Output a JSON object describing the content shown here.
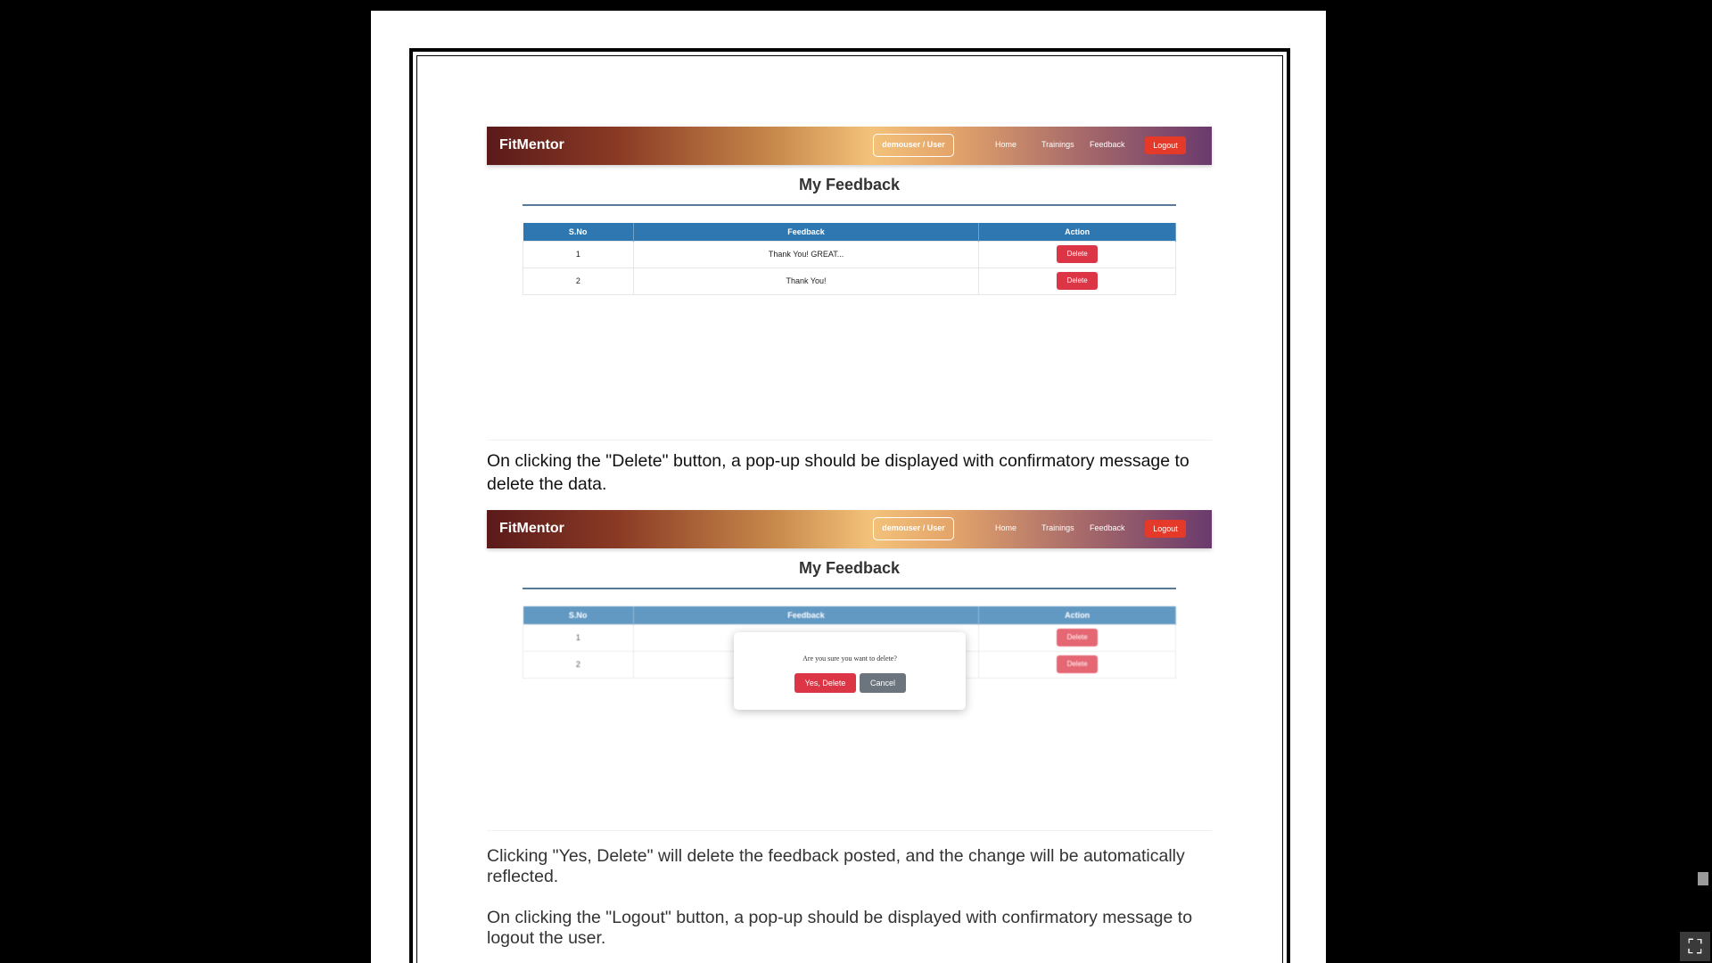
{
  "shot1": {
    "brand": "FitMentor",
    "user_badge": "demouser / User",
    "nav": {
      "home": "Home",
      "trainings": "Trainings",
      "feedback": "Feedback",
      "logout": "Logout"
    },
    "title": "My Feedback",
    "table": {
      "headers": [
        "S.No",
        "Feedback",
        "Action"
      ],
      "rows": [
        {
          "sno": "1",
          "feedback": "Thank You! GREAT...",
          "action": "Delete"
        },
        {
          "sno": "2",
          "feedback": "Thank You!",
          "action": "Delete"
        }
      ]
    }
  },
  "para1": "On clicking the \"Delete\" button, a pop-up should be displayed with confirmatory message to delete the data.",
  "shot2": {
    "brand": "FitMentor",
    "user_badge": "demouser / User",
    "nav": {
      "home": "Home",
      "trainings": "Trainings",
      "feedback": "Feedback",
      "logout": "Logout"
    },
    "title": "My Feedback",
    "table": {
      "headers": [
        "S.No",
        "Feedback",
        "Action"
      ],
      "rows": [
        {
          "sno": "1",
          "action": "Delete"
        },
        {
          "sno": "2",
          "action": "Delete"
        }
      ]
    },
    "modal": {
      "message": "Are you sure you want to delete?",
      "confirm": "Yes, Delete",
      "cancel": "Cancel"
    }
  },
  "para2": "Clicking \"Yes, Delete\" will delete the feedback posted, and the change will be automatically reflected.",
  "para3": "On clicking the \"Logout\" button, a pop-up should be displayed with confirmatory message to logout the user.",
  "viewer": {
    "exit_fullscreen_icon": "exit-fullscreen-icon",
    "exit_glyph": "⛶"
  }
}
